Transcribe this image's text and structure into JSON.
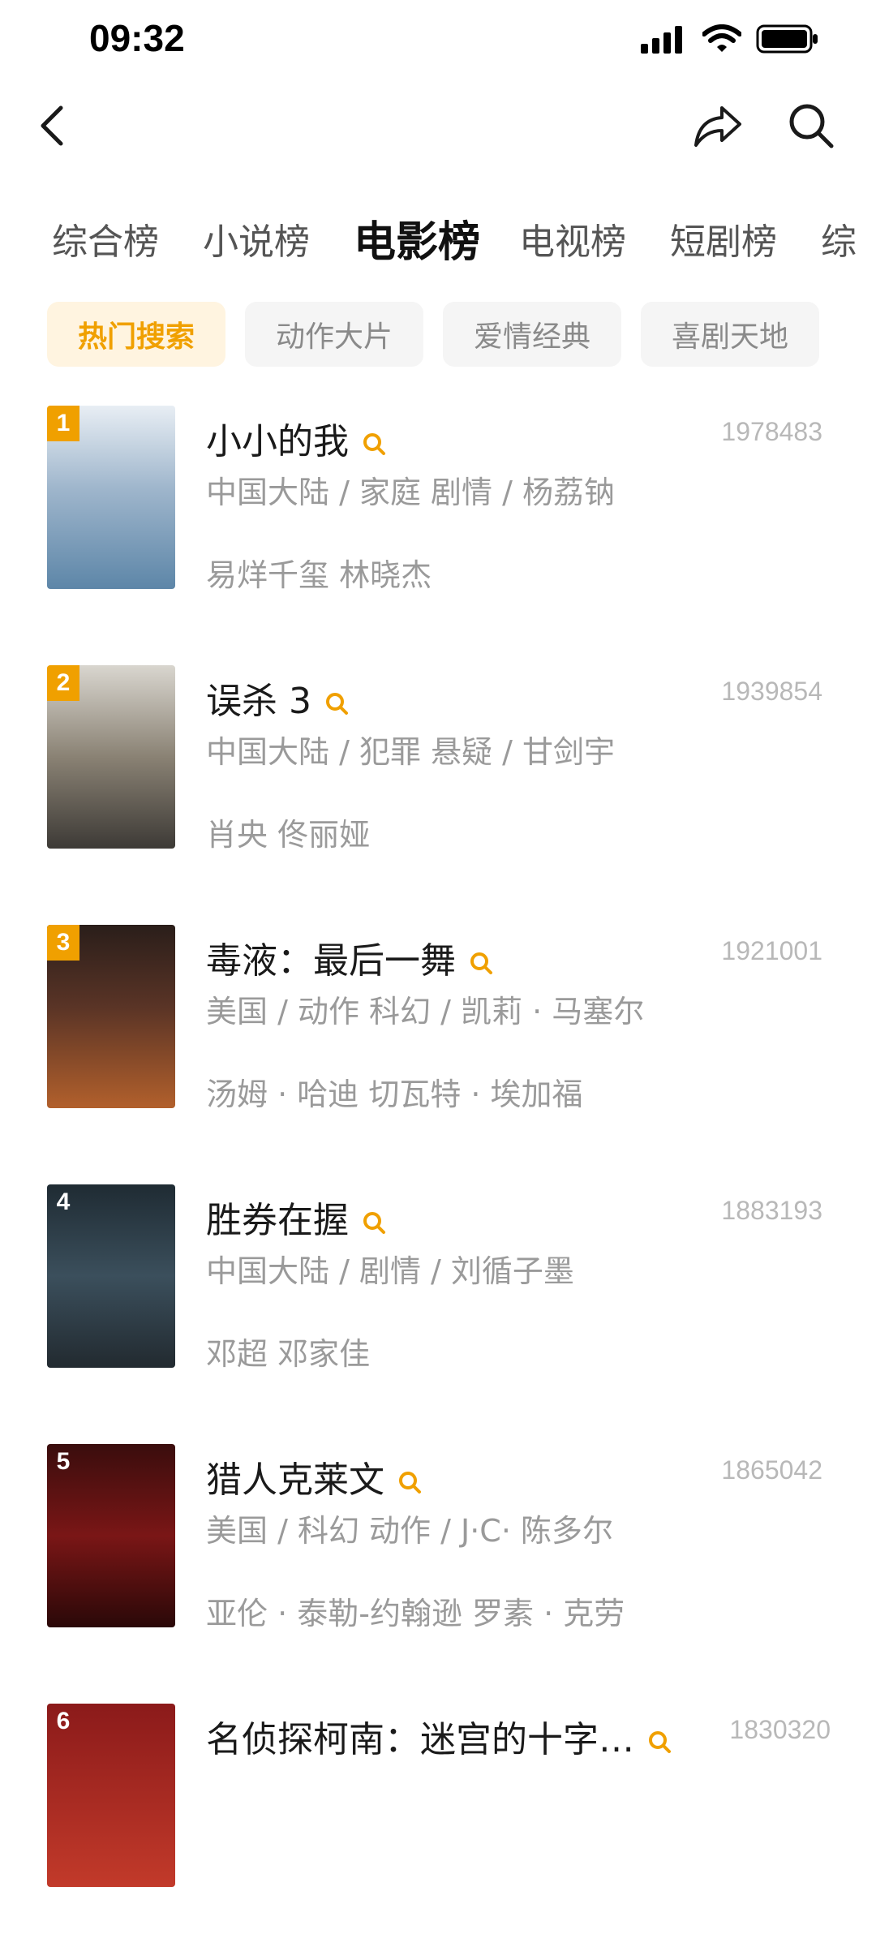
{
  "status": {
    "time": "09:32"
  },
  "tabs": [
    "综合榜",
    "小说榜",
    "电影榜",
    "电视榜",
    "短剧榜",
    "综"
  ],
  "active_tab": 2,
  "chips": [
    "热门搜索",
    "动作大片",
    "爱情经典",
    "喜剧天地"
  ],
  "active_chip": 0,
  "colors": {
    "accent": "#f0a000",
    "chip_active_bg": "#fff4e0"
  },
  "items": [
    {
      "rank": "1",
      "title": "小小的我",
      "score": "1978483",
      "meta": "中国大陆 / 家庭 剧情 / 杨荔钠",
      "cast": "易烊千玺 林晓杰"
    },
    {
      "rank": "2",
      "title": "误杀 3",
      "score": "1939854",
      "meta": "中国大陆 / 犯罪 悬疑 / 甘剑宇",
      "cast": "肖央 佟丽娅"
    },
    {
      "rank": "3",
      "title": "毒液：最后一舞",
      "score": "1921001",
      "meta": "美国 / 动作 科幻 / 凯莉 · 马塞尔",
      "cast": "汤姆 · 哈迪   切瓦特 · 埃加福"
    },
    {
      "rank": "4",
      "title": "胜券在握",
      "score": "1883193",
      "meta": "中国大陆 / 剧情 / 刘循子墨",
      "cast": "邓超 邓家佳"
    },
    {
      "rank": "5",
      "title": "猎人克莱文",
      "score": "1865042",
      "meta": "美国 / 科幻 动作 / J·C· 陈多尔",
      "cast": "亚伦 · 泰勒-约翰逊 罗素 · 克劳"
    },
    {
      "rank": "6",
      "title": "名侦探柯南：迷宫的十字…",
      "score": "1830320",
      "meta": "",
      "cast": ""
    }
  ]
}
